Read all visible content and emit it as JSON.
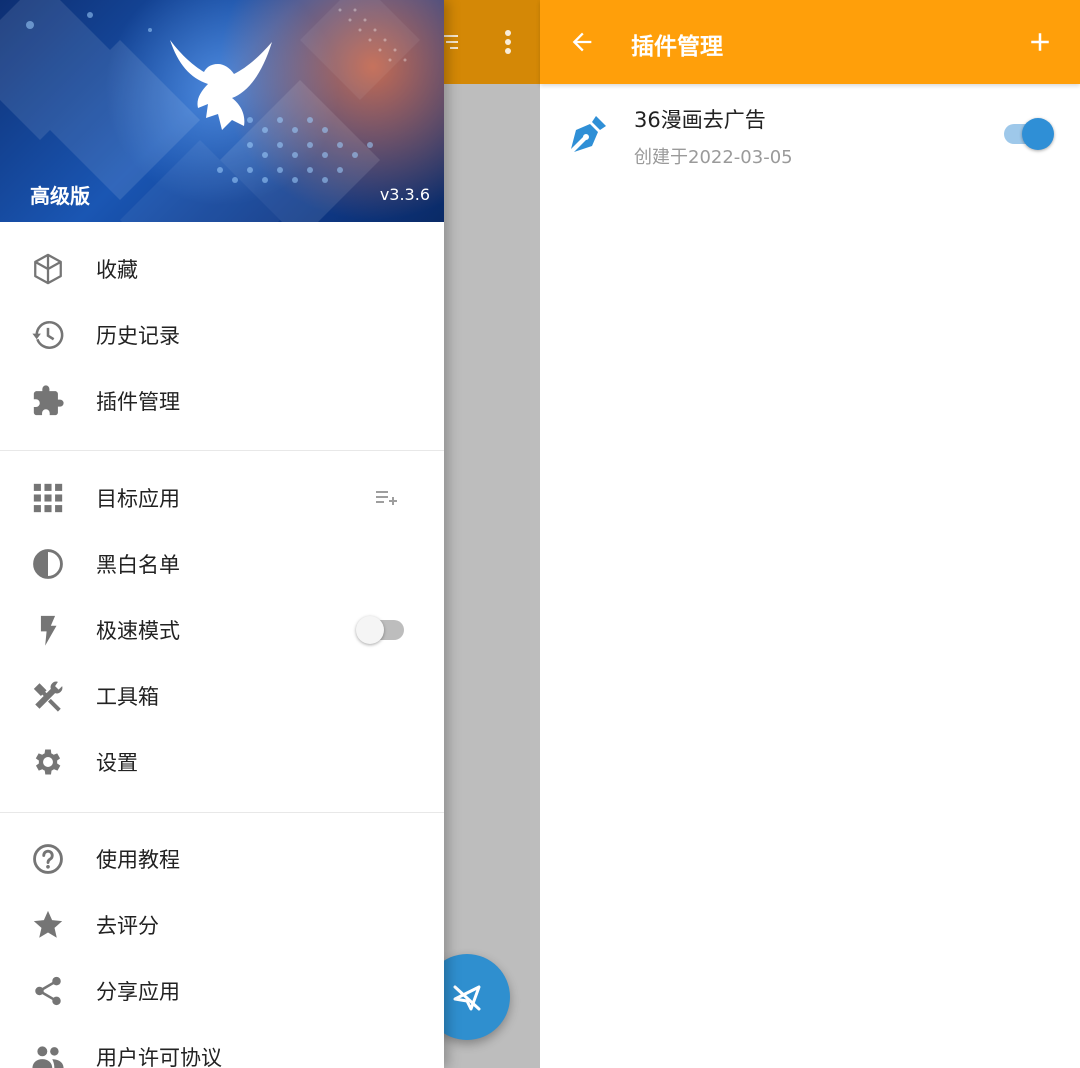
{
  "main": {
    "icons": {
      "filter": "filter-list-icon",
      "more": "more-vert-icon",
      "fab": "send-off-icon"
    }
  },
  "drawer": {
    "edition": "高级版",
    "version": "v3.3.6",
    "logo": "eagle-logo",
    "section1": [
      {
        "label": "收藏",
        "icon": "cube-icon"
      },
      {
        "label": "历史记录",
        "icon": "history-icon"
      },
      {
        "label": "插件管理",
        "icon": "puzzle-icon"
      }
    ],
    "section2": [
      {
        "label": "目标应用",
        "icon": "apps-grid-icon",
        "trailing": "playlist-add-icon"
      },
      {
        "label": "黑白名单",
        "icon": "contrast-icon"
      },
      {
        "label": "极速模式",
        "icon": "flash-icon",
        "toggle": false
      },
      {
        "label": "工具箱",
        "icon": "tools-icon"
      },
      {
        "label": "设置",
        "icon": "gear-icon"
      }
    ],
    "section3": [
      {
        "label": "使用教程",
        "icon": "help-icon"
      },
      {
        "label": "去评分",
        "icon": "star-icon"
      },
      {
        "label": "分享应用",
        "icon": "share-icon"
      },
      {
        "label": "用户许可协议",
        "icon": "people-icon"
      }
    ]
  },
  "plugin_page": {
    "title": "插件管理",
    "icons": {
      "back": "arrow-back-icon",
      "add": "add-icon"
    },
    "plugins": [
      {
        "name": "36漫画去广告",
        "created": "创建于2022-03-05",
        "icon": "pen-nib-icon",
        "enabled": true
      }
    ]
  },
  "colors": {
    "accent": "#ff9f0a",
    "switch_on": "#2f8fd6",
    "switch_off_track": "#bdbdbd"
  }
}
